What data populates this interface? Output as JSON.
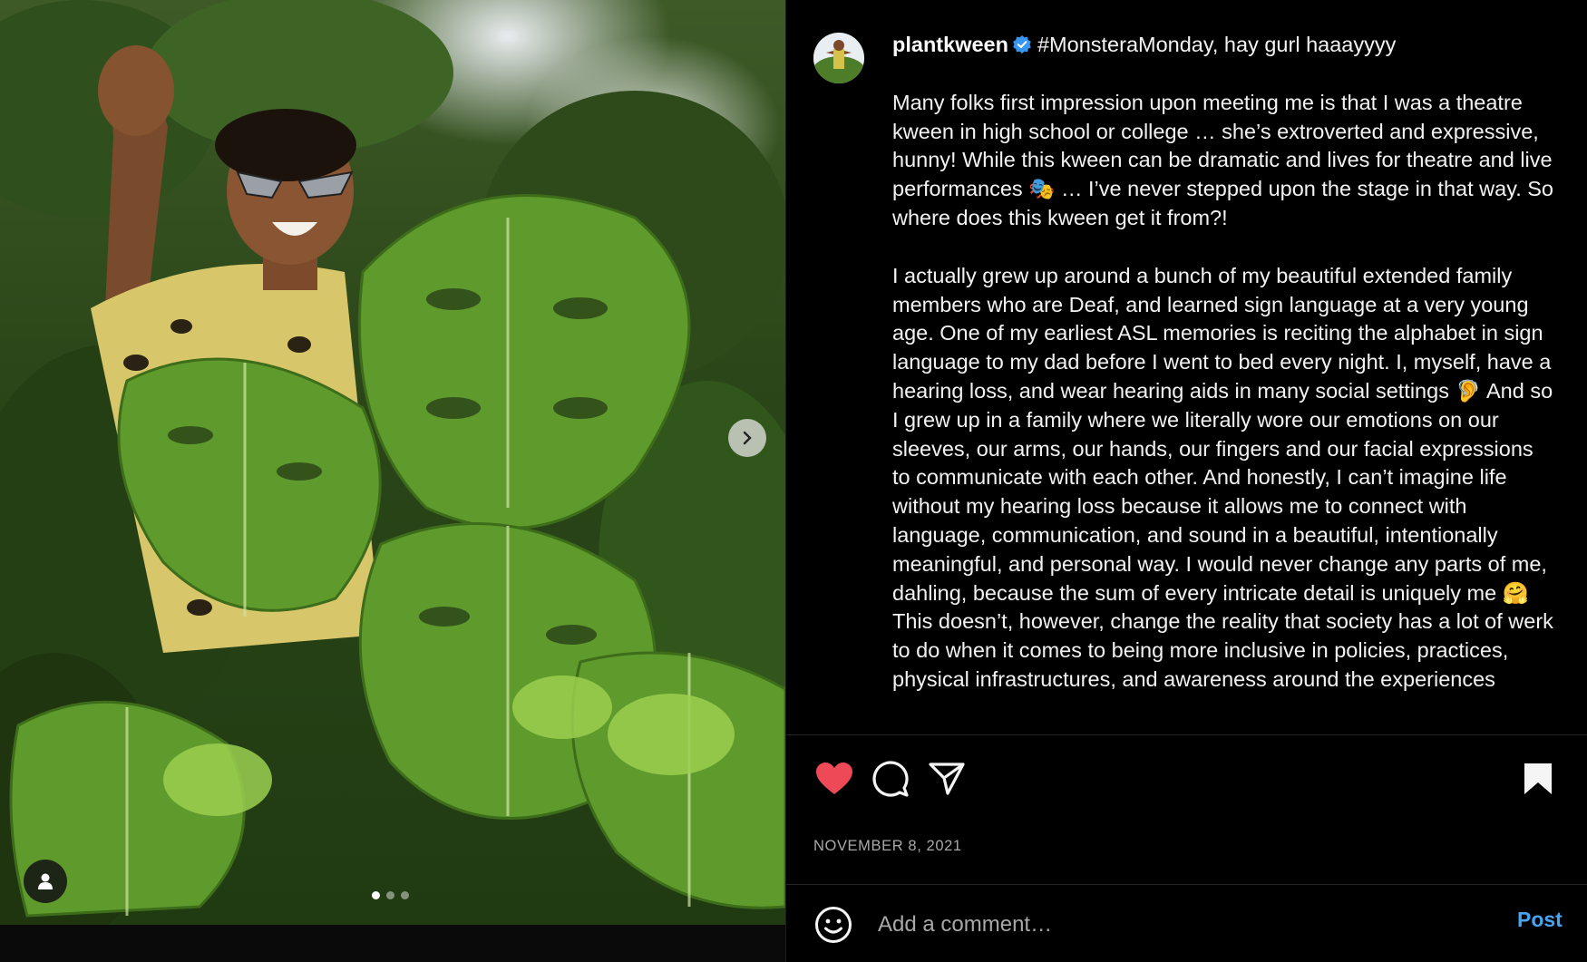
{
  "post": {
    "username": "plantkween",
    "title_text": "#MonsteraMonday, hay gurl haaayyyy",
    "caption_paragraphs": [
      "Many folks first impression upon meeting me is that I was a theatre kween in high school or college … she’s extroverted and expressive, hunny! While this kween can be dramatic and lives for theatre and live performances 🎭 … I’ve never stepped upon the stage in that way. So where does this kween get it from?!",
      "I actually grew up around a bunch of my beautiful extended family members who are Deaf, and learned sign language at a very young age. One of my earliest ASL memories is reciting the alphabet in sign language to my dad before I went to bed every night. I, myself, have a hearing loss, and wear hearing aids in many social settings 🦻 And so I grew up in a family where we literally wore our emotions on our sleeves, our arms, our hands, our fingers and our facial expressions to communicate with each other. And honestly, I can’t imagine life without my hearing loss because it allows me to connect with language, communication, and sound in a beautiful, intentionally meaningful, and personal way. I would never change any parts of me, dahling, because the sum of every intricate detail is uniquely me 🤗 This doesn’t, however, change the reality that society has a lot of werk to do when it comes to being more inclusive in policies, practices, physical infrastructures, and awareness around the experiences"
    ],
    "date": "NOVEMBER 8, 2021",
    "liked": true,
    "carousel": {
      "total": 3,
      "current": 1
    }
  },
  "comment": {
    "placeholder": "Add a comment…",
    "post_label": "Post"
  },
  "icons": {
    "verified": "verified-badge-icon",
    "like": "heart-icon",
    "comment": "comment-icon",
    "share": "share-icon",
    "save": "bookmark-icon",
    "emoji": "emoji-icon",
    "user_tag": "user-icon",
    "next": "chevron-right-icon"
  },
  "colors": {
    "background": "#000000",
    "like_red": "#ed4956",
    "verified_blue": "#3897f0",
    "post_blue": "#4aa3f0",
    "muted_text": "#a8a8a8"
  }
}
